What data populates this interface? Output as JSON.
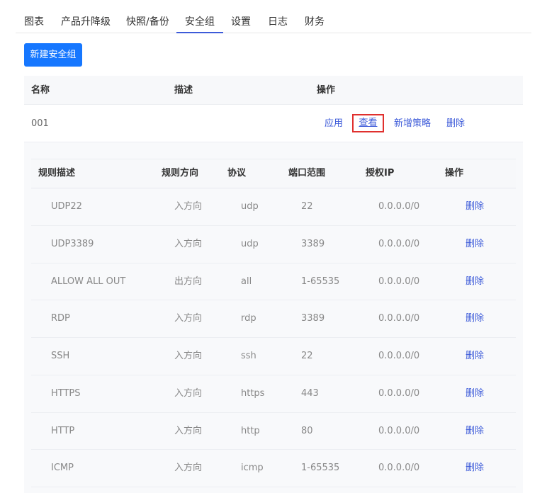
{
  "tabs": [
    "图表",
    "产品升降级",
    "快照/备份",
    "安全组",
    "设置",
    "日志",
    "财务"
  ],
  "active_tab": "安全组",
  "new_button": "新建安全组",
  "outer_table": {
    "headers": [
      "名称",
      "描述",
      "操作"
    ],
    "row": {
      "name": "001",
      "description": "",
      "actions": [
        "应用",
        "查看",
        "新增策略",
        "删除"
      ]
    }
  },
  "inner_table": {
    "headers": [
      "规则描述",
      "规则方向",
      "协议",
      "端口范围",
      "授权IP",
      "操作"
    ],
    "rows": [
      [
        "UDP22",
        "入方向",
        "udp",
        "22",
        "0.0.0.0/0",
        "删除"
      ],
      [
        "UDP3389",
        "入方向",
        "udp",
        "3389",
        "0.0.0.0/0",
        "删除"
      ],
      [
        "ALLOW ALL OUT",
        "出方向",
        "all",
        "1-65535",
        "0.0.0.0/0",
        "删除"
      ],
      [
        "RDP",
        "入方向",
        "rdp",
        "3389",
        "0.0.0.0/0",
        "删除"
      ],
      [
        "SSH",
        "入方向",
        "ssh",
        "22",
        "0.0.0.0/0",
        "删除"
      ],
      [
        "HTTPS",
        "入方向",
        "https",
        "443",
        "0.0.0.0/0",
        "删除"
      ],
      [
        "HTTP",
        "入方向",
        "http",
        "80",
        "0.0.0.0/0",
        "删除"
      ],
      [
        "ICMP",
        "入方向",
        "icmp",
        "1-65535",
        "0.0.0.0/0",
        "删除"
      ]
    ]
  }
}
